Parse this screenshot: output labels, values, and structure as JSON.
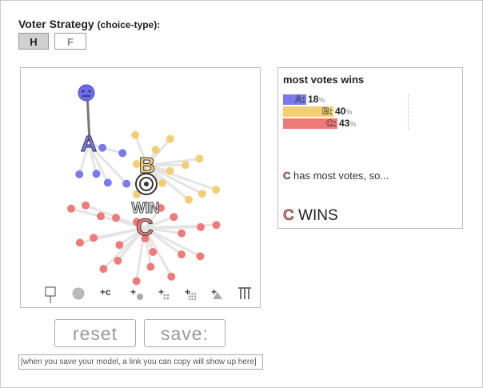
{
  "strategy": {
    "title": "Voter Strategy",
    "subtitle": "(choice-type):",
    "options": [
      "H",
      "F"
    ],
    "selected": "H"
  },
  "candidates": [
    {
      "letter": "A",
      "color": "#7a7aee"
    },
    {
      "letter": "B",
      "color": "#f2cf77"
    },
    {
      "letter": "C",
      "color": "#ef7a7a"
    }
  ],
  "sim": {
    "win_label": "WIN",
    "toolbar": [
      {
        "name": "voter-ballot-icon",
        "label": ""
      },
      {
        "name": "settings-gear-icon",
        "label": ""
      },
      {
        "name": "add-candidate-icon",
        "label": "+c"
      },
      {
        "name": "add-voter-icon",
        "label": "+"
      },
      {
        "name": "add-voter-group-icon",
        "label": "+"
      },
      {
        "name": "add-voter-crowd-icon",
        "label": "+"
      },
      {
        "name": "add-triangle-icon",
        "label": "+"
      },
      {
        "name": "delete-trash-icon",
        "label": ""
      }
    ]
  },
  "result": {
    "title": "most votes wins",
    "bars": [
      {
        "letter": "A",
        "value": "18",
        "percent_sign": "%",
        "share": 0.18
      },
      {
        "letter": "B",
        "value": "40",
        "percent_sign": "%",
        "share": 0.4
      },
      {
        "letter": "C",
        "value": "43",
        "percent_sign": "%",
        "share": 0.43
      }
    ],
    "message_letter": "C",
    "message_text": " has most votes, so...",
    "winner_letter": "C",
    "winner_text": " WINS"
  },
  "actions": {
    "reset_label": "reset",
    "save_label": "save:",
    "link_placeholder": "[when you save your model, a link you can copy will show up here]"
  }
}
